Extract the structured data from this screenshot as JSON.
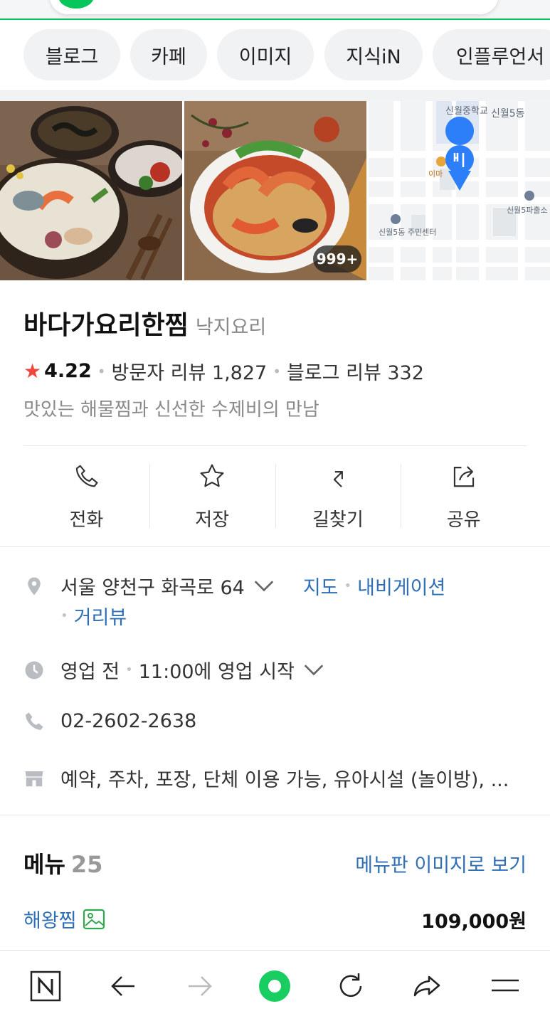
{
  "chips": [
    "블로그",
    "카페",
    "이미지",
    "지식iN",
    "인플루언서"
  ],
  "images": {
    "more_badge": "999+",
    "map_labels": [
      "신월중학교",
      "신월5동",
      "이마",
      "신월5파출소",
      "신월5동 주민센터"
    ]
  },
  "place": {
    "name": "바다가요리한찜",
    "category": "낙지요리",
    "rating": "4.22",
    "visitor_reviews": "방문자 리뷰 1,827",
    "blog_reviews": "블로그 리뷰 332",
    "description": "맛있는 해물찜과 신선한 수제비의 만남"
  },
  "actions": [
    {
      "label": "전화",
      "icon": "phone-icon"
    },
    {
      "label": "저장",
      "icon": "star-icon"
    },
    {
      "label": "길찾기",
      "icon": "directions-icon"
    },
    {
      "label": "공유",
      "icon": "share-icon"
    }
  ],
  "details": {
    "address": "서울 양천구 화곡로 64",
    "map_link": "지도",
    "navigation_link": "내비게이션",
    "streetview_link": "거리뷰",
    "hours_status": "영업 전",
    "hours_text": "11:00에 영업 시작",
    "phone": "02-2602-2638",
    "amenities": "예약, 주차, 포장, 단체 이용 가능, 유아시설 (놀이방), ..."
  },
  "menu": {
    "title": "메뉴",
    "count": "25",
    "board_link": "메뉴판 이미지로 보기",
    "items": [
      {
        "name": "해왕찜",
        "price": "109,000원"
      }
    ]
  },
  "colors": {
    "brand_green": "#03c75a",
    "link_blue": "#2e6fb7",
    "star_red": "#f0463c"
  }
}
